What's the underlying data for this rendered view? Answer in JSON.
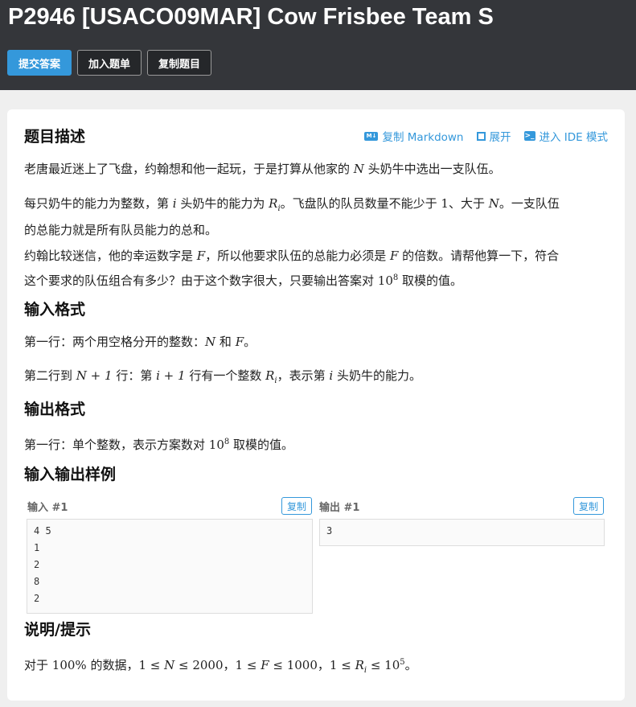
{
  "header": {
    "title": "P2946 [USACO09MAR] Cow Frisbee Team S",
    "buttons": {
      "submit": "提交答案",
      "add_to_list": "加入题单",
      "copy_problem": "复制题目"
    }
  },
  "toolbar": {
    "copy_markdown": "复制 Markdown",
    "expand": "展开",
    "ide_mode": "进入 IDE 模式"
  },
  "description": {
    "title": "题目描述",
    "p1": {
      "pre": "老唐最近迷上了飞盘，约翰想和他一起玩，于是打算从他家的 ",
      "m1": "N",
      "post": " 头奶牛中选出一支队伍。"
    },
    "p2": {
      "a": "每只奶牛的能力为整数，第 ",
      "m1": "i",
      "b": " 头奶牛的能力为 ",
      "m2": "R",
      "m2sub": "i",
      "c": "。飞盘队的队员数量不能少于 ",
      "n1": "1",
      "d": "、大于 ",
      "m3": "N",
      "e": "。一支队伍",
      "line2": "的总能力就是所有队员能力的总和。"
    },
    "p3": {
      "a": "约翰比较迷信，他的幸运数字是 ",
      "m1": "F",
      "b": "，所以他要求队伍的总能力必须是 ",
      "m2": "F",
      "c": " 的倍数。请帮他算一下，符合",
      "line2a": "这个要求的队伍组合有多少？由于这个数字很大，只要输出答案对 ",
      "n1": "10",
      "n1sup": "8",
      "line2b": " 取模的值。"
    }
  },
  "input_format": {
    "title": "输入格式",
    "l1": {
      "a": "第一行：两个用空格分开的整数：",
      "m1": "N",
      "b": " 和 ",
      "m2": "F",
      "c": "。"
    },
    "l2": {
      "a": "第二行到 ",
      "m1": "N + 1",
      "b": " 行：第 ",
      "m2": "i + 1",
      "c": " 行有一个整数 ",
      "m3": "R",
      "m3sub": "i",
      "d": "，表示第 ",
      "m4": "i",
      "e": " 头奶牛的能力。"
    }
  },
  "output_format": {
    "title": "输出格式",
    "l1": {
      "a": "第一行：单个整数，表示方案数对 ",
      "n1": "10",
      "n1sup": "8",
      "b": " 取模的值。"
    }
  },
  "samples": {
    "title": "输入输出样例",
    "input_label": "输入 #1",
    "output_label": "输出 #1",
    "copy": "复制",
    "input": "4 5\n1\n2\n8\n2",
    "output": "3"
  },
  "hint": {
    "title": "说明/提示",
    "a": "对于 ",
    "pct": "100%",
    "b": " 的数据，",
    "c1": "1 ≤ ",
    "m1": "N",
    "c2": " ≤ 2000",
    "sep1": "，",
    "c3": "1 ≤ ",
    "m2": "F",
    "c4": " ≤ 1000",
    "sep2": "，",
    "c5": "1 ≤ ",
    "m3": "R",
    "m3sub": "i",
    "c6": " ≤ 10",
    "c6sup": "5",
    "end": "。"
  }
}
